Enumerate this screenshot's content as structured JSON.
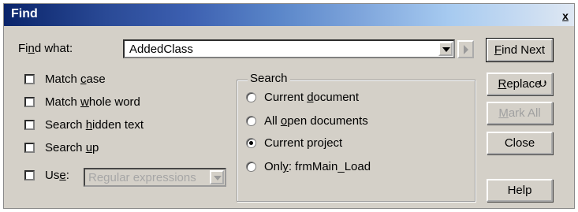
{
  "window": {
    "title": "Find",
    "close_glyph": "x"
  },
  "find_what": {
    "label_pre": "Fi",
    "label_key": "n",
    "label_post": "d what:",
    "value": "AddedClass"
  },
  "options": {
    "match_case": {
      "pre": "Match ",
      "key": "c",
      "post": "ase",
      "checked": false
    },
    "match_whole_word": {
      "pre": "Match ",
      "key": "w",
      "post": "hole word",
      "checked": false
    },
    "search_hidden_text": {
      "pre": "Search ",
      "key": "h",
      "post": "idden text",
      "checked": false
    },
    "search_up": {
      "pre": "Search ",
      "key": "u",
      "post": "p",
      "checked": false
    },
    "use": {
      "pre": "Us",
      "key": "e",
      "post": ":",
      "checked": false,
      "value": "Regular expressions"
    }
  },
  "search_group": {
    "title": "Search",
    "options": [
      {
        "pre": "Current ",
        "key": "d",
        "post": "ocument",
        "selected": false
      },
      {
        "pre": "All ",
        "key": "o",
        "post": "pen documents",
        "selected": false
      },
      {
        "pre": "Current project",
        "key": "",
        "post": "",
        "selected": true
      },
      {
        "pre": "Onl",
        "key": "y",
        "post": ": frmMain_Load",
        "selected": false
      }
    ]
  },
  "buttons": {
    "find_next": {
      "pre": "",
      "key": "F",
      "post": "ind Next"
    },
    "replace": {
      "pre": "",
      "key": "R",
      "post": "eplace",
      "extra": "⮋"
    },
    "mark_all": {
      "pre": "",
      "key": "M",
      "post": "ark All"
    },
    "close": "Close",
    "help": "Help"
  },
  "colors": {
    "dialog_bg": "#d4d0c8",
    "title_gradient_start": "#0a246a",
    "title_gradient_end": "#dfe8f3",
    "disabled_text": "#a0a0a0"
  }
}
